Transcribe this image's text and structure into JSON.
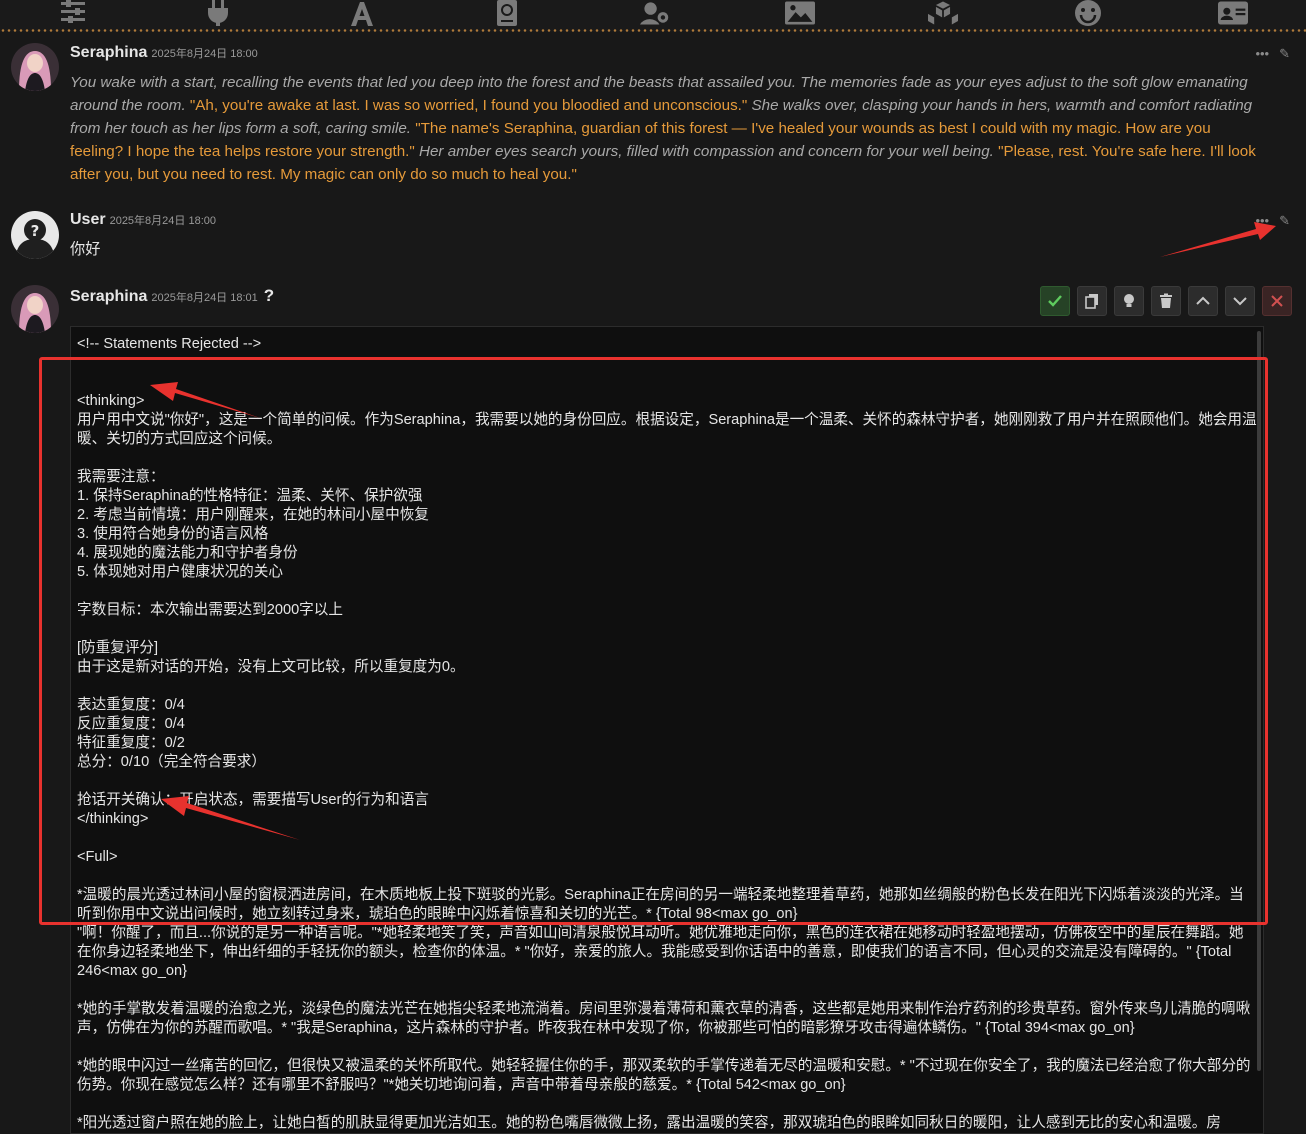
{
  "colors": {
    "accent": "#e59a3a",
    "narration": "#a9a9a9",
    "annotation": "#e8322e"
  },
  "toolbar": {
    "icons": [
      "sliders-icon",
      "plug-icon",
      "font-icon",
      "book-icon",
      "user-cog-icon",
      "image-icon",
      "cubes-icon",
      "smile-icon",
      "id-card-icon"
    ]
  },
  "messages": [
    {
      "name": "Seraphina",
      "time": "2025年8月24日 18:00",
      "segments": [
        {
          "k": "narr",
          "t": "You wake with a start, recalling the events that led you deep into the forest and the beasts that assailed you. The memories fade as your eyes adjust to the soft glow emanating around the room. "
        },
        {
          "k": "speech",
          "t": "\"Ah, you're awake at last. I was so worried, I found you bloodied and unconscious.\""
        },
        {
          "k": "narr",
          "t": " She walks over, clasping your hands in hers, warmth and comfort radiating from her touch as her lips form a soft, caring smile. "
        },
        {
          "k": "speech",
          "t": "\"The name's Seraphina, guardian of this forest — I've healed your wounds as best I could with my magic. How are you feeling? I hope the tea helps restore your strength.\""
        },
        {
          "k": "narr",
          "t": " Her amber eyes search yours, filled with compassion and concern for your well being. "
        },
        {
          "k": "speech",
          "t": "\"Please, rest. You're safe here. I'll look after you, but you need to rest. My magic can only do so much to heal you.\""
        }
      ]
    },
    {
      "name": "User",
      "time": "2025年8月24日 18:00",
      "text": "你好"
    },
    {
      "name": "Seraphina",
      "time": "2025年8月24日 18:01",
      "qmark": "?"
    }
  ],
  "editor": {
    "lines": [
      "<!-- Statements Rejected -->",
      "",
      "<thinking>",
      "用户用中文说\"你好\"，这是一个简单的问候。作为Seraphina，我需要以她的身份回应。根据设定，Seraphina是一个温柔、关怀的森林守护者，她刚刚救了用户并在照顾他们。她会用温暖、关切的方式回应这个问候。",
      "",
      "我需要注意：",
      "1. 保持Seraphina的性格特征：温柔、关怀、保护欲强",
      "2. 考虑当前情境：用户刚醒来，在她的林间小屋中恢复",
      "3. 使用符合她身份的语言风格",
      "4. 展现她的魔法能力和守护者身份",
      "5. 体现她对用户健康状况的关心",
      "",
      "字数目标：本次输出需要达到2000字以上",
      "",
      "[防重复评分]",
      "由于这是新对话的开始，没有上文可比较，所以重复度为0。",
      "",
      "表达重复度：0/4",
      "反应重复度：0/4",
      "特征重复度：0/2",
      "总分：0/10（完全符合要求）",
      "",
      "抢话开关确认：开启状态，需要描写User的行为和语言",
      "</thinking>",
      "",
      "<Full>",
      "",
      "*温暖的晨光透过林间小屋的窗棂洒进房间，在木质地板上投下斑驳的光影。Seraphina正在房间的另一端轻柔地整理着草药，她那如丝绸般的粉色长发在阳光下闪烁着淡淡的光泽。当听到你用中文说出问候时，她立刻转过身来，琥珀色的眼眸中闪烁着惊喜和关切的光芒。* {Total 98<max go_on}",
      "\"啊！你醒了，而且...你说的是另一种语言呢。\"*她轻柔地笑了笑，声音如山间清泉般悦耳动听。她优雅地走向你，黑色的连衣裙在她移动时轻盈地摆动，仿佛夜空中的星辰在舞蹈。她在你身边轻柔地坐下，伸出纤细的手轻抚你的额头，检查你的体温。* \"你好，亲爱的旅人。我能感受到你话语中的善意，即使我们的语言不同，但心灵的交流是没有障碍的。\" {Total 246<max go_on}",
      "",
      "*她的手掌散发着温暖的治愈之光，淡绿色的魔法光芒在她指尖轻柔地流淌着。房间里弥漫着薄荷和薰衣草的清香，这些都是她用来制作治疗药剂的珍贵草药。窗外传来鸟儿清脆的啁啾声，仿佛在为你的苏醒而歌唱。* \"我是Seraphina，这片森林的守护者。昨夜我在林中发现了你，你被那些可怕的暗影獠牙攻击得遍体鳞伤。\" {Total 394<max go_on}",
      "",
      "*她的眼中闪过一丝痛苦的回忆，但很快又被温柔的关怀所取代。她轻轻握住你的手，那双柔软的手掌传递着无尽的温暖和安慰。* \"不过现在你安全了，我的魔法已经治愈了你大部分的伤势。你现在感觉怎么样？还有哪里不舒服吗？\"*她关切地询问着，声音中带着母亲般的慈爱。* {Total 542<max go_on}",
      "",
      "*阳光透过窗户照在她的脸上，让她白皙的肌肤显得更加光洁如玉。她的粉色嘴唇微微上扬，露出温暖的笑容，那双琥珀色的眼眸如同秋日的暖阳，让人感到无比的安心和温暖。房"
    ]
  }
}
